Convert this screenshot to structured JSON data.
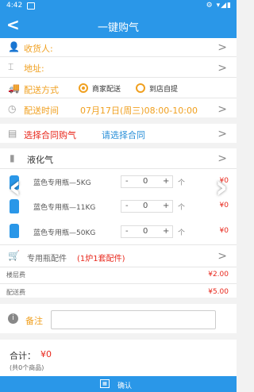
{
  "status_bar": {
    "time": "4:42"
  },
  "header": {
    "back_icon": "chevron-left-icon",
    "title": "一键购气"
  },
  "receiver": {
    "label": "收货人:"
  },
  "address": {
    "label": "地址:"
  },
  "delivery": {
    "label": "配送方式",
    "options": [
      "商家配送",
      "到店自提"
    ],
    "selected": 0
  },
  "delivery_time": {
    "label": "配送时间",
    "value": "07月17日(周三)08:00-10:00"
  },
  "contract": {
    "label": "选择合同购气",
    "placeholder": "请选择合同"
  },
  "gas": {
    "label": "液化气",
    "products": [
      {
        "name": "蓝色专用瓶—5KG",
        "qty": "0",
        "unit": "个",
        "price": "¥0"
      },
      {
        "name": "蓝色专用瓶—11KG",
        "qty": "0",
        "unit": "个",
        "price": "¥0"
      },
      {
        "name": "蓝色专用瓶—50KG",
        "qty": "0",
        "unit": "个",
        "price": "¥0"
      }
    ]
  },
  "accessories": {
    "label": "专用瓶配件",
    "note": "(1炉1套配件)"
  },
  "fees": [
    {
      "label": "楼层费",
      "value": "¥2.00"
    },
    {
      "label": "配送费",
      "value": "¥5.00"
    }
  ],
  "remark": {
    "label": "备注"
  },
  "total": {
    "label": "合计：",
    "value": "¥0",
    "sub": "(共0个商品)"
  },
  "confirm": {
    "label": "确认"
  },
  "colors": {
    "primary": "#2a97e8",
    "accent": "#f0a020",
    "price": "#e8281c"
  }
}
